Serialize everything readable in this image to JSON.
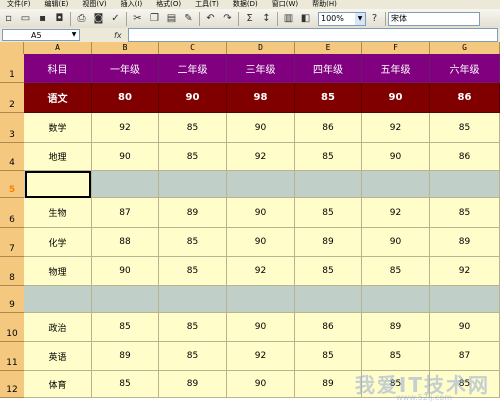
{
  "menu": [
    "文件(F)",
    "编辑(E)",
    "视图(V)",
    "插入(I)",
    "格式(O)",
    "工具(T)",
    "数据(D)",
    "窗口(W)",
    "帮助(H)"
  ],
  "toolbar": {
    "zoom": "100%",
    "font": "宋体",
    "sum_symbol": "Σ"
  },
  "name_box": "A5",
  "fx_label": "fx",
  "columns": [
    "A",
    "B",
    "C",
    "D",
    "E",
    "F",
    "G"
  ],
  "row_numbers": [
    "1",
    "2",
    "3",
    "4",
    "5",
    "6",
    "7",
    "8",
    "9",
    "10",
    "11",
    "12"
  ],
  "header_row": [
    "科目",
    "一年级",
    "二年级",
    "三年级",
    "四年级",
    "五年级",
    "六年级"
  ],
  "rows": [
    {
      "subject": "语文",
      "values": [
        "80",
        "90",
        "98",
        "85",
        "90",
        "86"
      ]
    },
    {
      "subject": "数学",
      "values": [
        "92",
        "85",
        "90",
        "86",
        "92",
        "85"
      ]
    },
    {
      "subject": "地理",
      "values": [
        "90",
        "85",
        "92",
        "85",
        "90",
        "86"
      ]
    },
    {
      "subject": "",
      "values": [
        "",
        "",
        "",
        "",
        "",
        ""
      ]
    },
    {
      "subject": "生物",
      "values": [
        "87",
        "89",
        "90",
        "85",
        "92",
        "85"
      ]
    },
    {
      "subject": "化学",
      "values": [
        "88",
        "85",
        "90",
        "89",
        "90",
        "89"
      ]
    },
    {
      "subject": "物理",
      "values": [
        "90",
        "85",
        "92",
        "85",
        "85",
        "92"
      ]
    },
    {
      "subject": "",
      "values": [
        "",
        "",
        "",
        "",
        "",
        ""
      ]
    },
    {
      "subject": "政治",
      "values": [
        "85",
        "85",
        "90",
        "86",
        "89",
        "90"
      ]
    },
    {
      "subject": "英语",
      "values": [
        "89",
        "85",
        "92",
        "85",
        "85",
        "87"
      ]
    },
    {
      "subject": "体育",
      "values": [
        "85",
        "89",
        "90",
        "89",
        "85",
        "85"
      ]
    }
  ],
  "watermark": {
    "main": "我爱IT技术网",
    "sub": "www.52ij.com"
  },
  "colors": {
    "header_purple": "#800080",
    "first_row_red": "#800000",
    "data_fill": "#fffdc9",
    "blank_fill": "#c0cfc8",
    "row_col_header": "#f4c97f"
  }
}
